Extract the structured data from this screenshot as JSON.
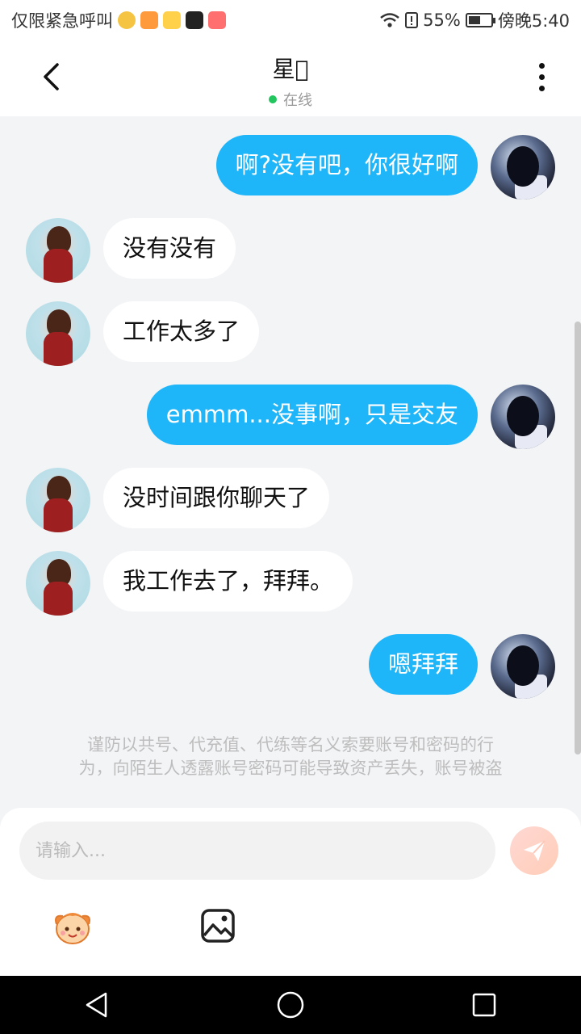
{
  "status_bar": {
    "left_text": "仅限紧急呼叫",
    "battery": "55%",
    "time": "傍晚5:40"
  },
  "header": {
    "title": "星\u0000",
    "status": "在线"
  },
  "messages": [
    {
      "side": "out",
      "text": "啊?没有吧，你很好啊"
    },
    {
      "side": "in",
      "text": "没有没有"
    },
    {
      "side": "in",
      "text": "工作太多了"
    },
    {
      "side": "out",
      "text": "emmm...没事啊，只是交友"
    },
    {
      "side": "in",
      "text": "没时间跟你聊天了"
    },
    {
      "side": "in",
      "text": "我工作去了，拜拜。"
    },
    {
      "side": "out",
      "text": "嗯拜拜"
    }
  ],
  "notice": {
    "line1": "谨防以共号、代充值、代练等名义索要账号和密码的行",
    "line2": "为，向陌生人透露账号密码可能导致资产丢失，账号被盗"
  },
  "input": {
    "placeholder": "请输入..."
  },
  "colors": {
    "outgoing_bubble": "#1fb5f9",
    "incoming_bubble": "#ffffff",
    "chat_background": "#f3f4f6",
    "online_dot": "#22c55e"
  }
}
